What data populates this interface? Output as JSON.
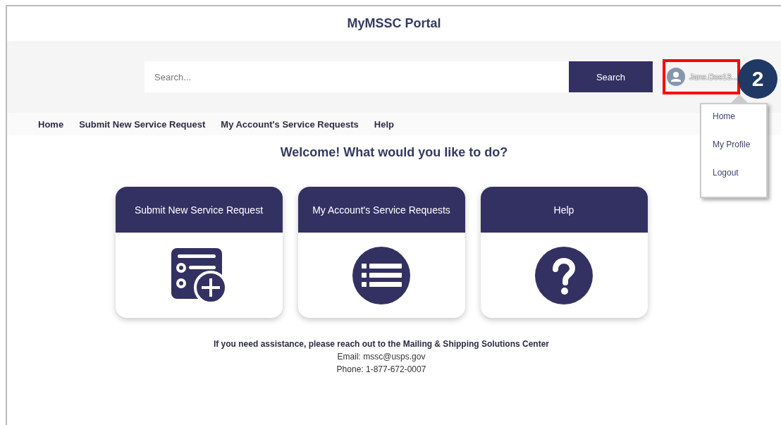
{
  "header": {
    "title": "MyMSSC Portal"
  },
  "search": {
    "placeholder": "Search...",
    "button": "Search"
  },
  "user": {
    "name": "Jane.Doe13..."
  },
  "user_menu": {
    "items": [
      {
        "label": "Home"
      },
      {
        "label": "My Profile"
      },
      {
        "label": "Logout"
      }
    ]
  },
  "annotation": {
    "step": "2"
  },
  "nav": {
    "items": [
      {
        "label": "Home"
      },
      {
        "label": "Submit New Service Request"
      },
      {
        "label": "My Account's Service Requests"
      },
      {
        "label": "Help"
      }
    ]
  },
  "welcome": "Welcome! What would you like to do?",
  "cards": [
    {
      "title": "Submit New Service Request",
      "kind": "form"
    },
    {
      "title": "My Account's Service Requests",
      "kind": "list"
    },
    {
      "title": "Help",
      "kind": "help"
    }
  ],
  "footer": {
    "lines": [
      "If you need assistance, please reach out to the Mailing & Shipping Solutions Center",
      "Email: mssc@usps.gov",
      "Phone: 1-877-672-0007"
    ]
  }
}
